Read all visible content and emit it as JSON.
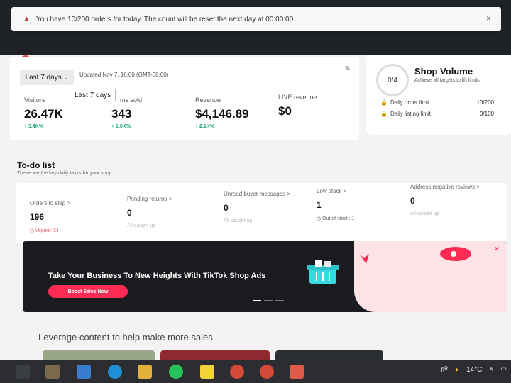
{
  "alert": {
    "text": "You have 10/200 orders for today. The count will be reset the next day at 00:00:00.",
    "close_icon": "×"
  },
  "stats": {
    "range_label": "Last 7 days",
    "updated": "Updated Nov 7, 16:00 (GMT-08:00)",
    "tooltip": "Last 7 days",
    "items": [
      {
        "label": "Visitors",
        "value": "26.47K",
        "delta": "+ 3.4K%"
      },
      {
        "label": "ms sold",
        "value": "343",
        "delta": "+ 1.6K%"
      },
      {
        "label": "Revenue",
        "value": "$4,146.89",
        "delta": "+ 2.1K%"
      },
      {
        "label": "LIVE revenue",
        "value": "$0",
        "delta": ""
      }
    ]
  },
  "shop_volume": {
    "progress": "0/4",
    "title": "Shop Volume",
    "subtitle": "Achieve all targets to lift limits",
    "rows": [
      {
        "label": "Daily order limit",
        "value": "10/200"
      },
      {
        "label": "Daily listing limit",
        "value": "0/100"
      }
    ]
  },
  "todo": {
    "title": "To-do list",
    "subtitle": "These are the key daily tasks for your shop.",
    "tasks": [
      {
        "label": "Orders to ship >",
        "value": "196",
        "footer": "Urgent: 34"
      },
      {
        "label": "Pending returns >",
        "value": "0",
        "footer": "All caught up"
      },
      {
        "label": "Unread buyer messages >",
        "value": "0",
        "footer": "All caught up"
      },
      {
        "label": "Low stock >",
        "value": "1",
        "footer": "Out of stock: 1"
      },
      {
        "label": "Address negative reviews >",
        "value": "0",
        "footer": "All caught up"
      }
    ]
  },
  "banner": {
    "title": "Take Your Business To New Heights With TikTok Shop Ads",
    "button": "Boost Sales Now"
  },
  "leverage": "Leverage content to help make more sales",
  "taskbar": {
    "temperature": "14°C"
  },
  "colors": {
    "accent": "#fe2c55",
    "positive": "#18a36b",
    "urgent": "#e25454"
  }
}
